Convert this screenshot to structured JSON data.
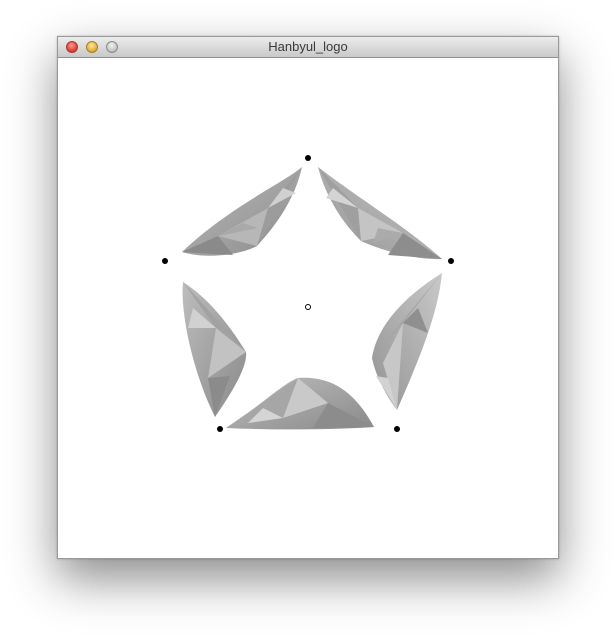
{
  "window": {
    "title": "Hanbyul_logo",
    "controls": [
      "close-button",
      "minimize-button",
      "zoom-button"
    ]
  },
  "canvas": {
    "background": "#ffffff",
    "shape_fill_light": "#c8c8c8",
    "shape_fill_mid": "#a5a5a5",
    "shape_fill_dark": "#7e7e7e",
    "marker_color": "#000000",
    "center_marker": "hollow-circle"
  }
}
